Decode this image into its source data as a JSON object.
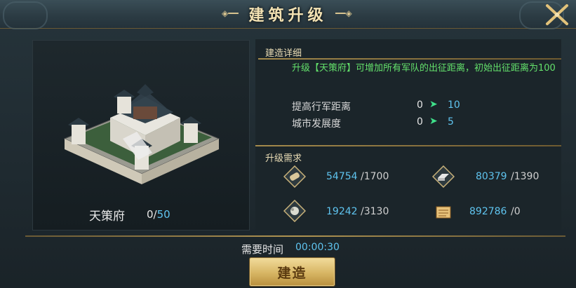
{
  "window": {
    "title": "建筑升级"
  },
  "building": {
    "name": "天策府",
    "current": "0",
    "separator": "/",
    "max": "50"
  },
  "details": {
    "section_label": "建造详细",
    "description": "升级【天策府】可增加所有军队的出征距离，初始出征距离为100",
    "stats": [
      {
        "label": "提高行军距离",
        "from": "0",
        "to": "10"
      },
      {
        "label": "城市发展度",
        "from": "0",
        "to": "5"
      }
    ]
  },
  "requirements": {
    "section_label": "升级需求",
    "items": [
      {
        "icon": "wood-scroll-icon",
        "have": "54754",
        "need": "/1700"
      },
      {
        "icon": "iron-ingot-icon",
        "have": "80379",
        "need": "/1390"
      },
      {
        "icon": "stone-ore-icon",
        "have": "19242",
        "need": "/3130"
      },
      {
        "icon": "grain-scroll-icon",
        "have": "892786",
        "need": "/0"
      }
    ]
  },
  "time": {
    "label": "需要时间",
    "value": "00:00:30"
  },
  "actions": {
    "build_label": "建造"
  },
  "colors": {
    "accent_blue": "#5fc4ef",
    "green_text": "#63e06b",
    "gold": "#d7b563"
  }
}
